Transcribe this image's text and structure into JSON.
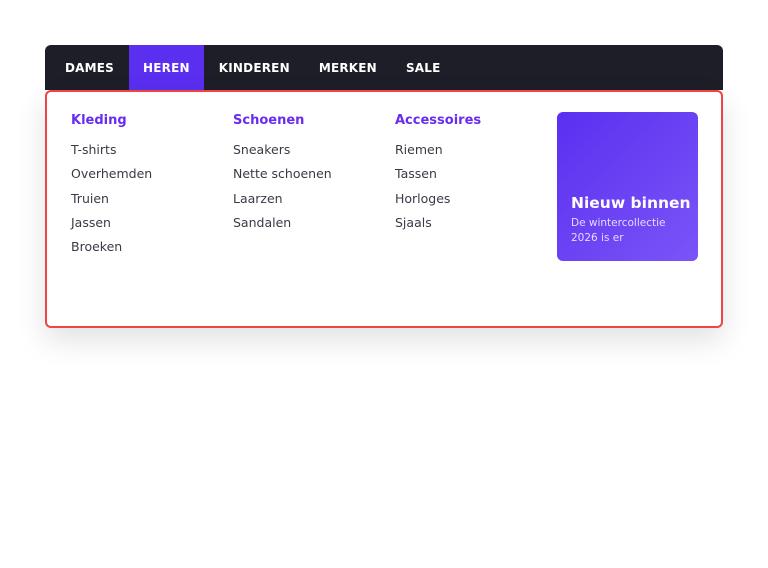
{
  "nav": {
    "items": [
      {
        "label": "DAMES",
        "active": false
      },
      {
        "label": "HEREN",
        "active": true
      },
      {
        "label": "KINDEREN",
        "active": false
      },
      {
        "label": "MERKEN",
        "active": false
      },
      {
        "label": "SALE",
        "active": false
      }
    ]
  },
  "menu": {
    "columns": [
      {
        "title": "Kleding",
        "links": [
          "T-shirts",
          "Overhemden",
          "Truien",
          "Jassen",
          "Broeken"
        ]
      },
      {
        "title": "Schoenen",
        "links": [
          "Sneakers",
          "Nette schoenen",
          "Laarzen",
          "Sandalen"
        ]
      },
      {
        "title": "Accessoires",
        "links": [
          "Riemen",
          "Tassen",
          "Horloges",
          "Sjaals"
        ]
      }
    ],
    "promo": {
      "title": "Nieuw binnen",
      "subtitle": "De wintercollectie 2026 is er"
    }
  },
  "colors": {
    "nav_bg": "#1e1e28",
    "accent": "#5a2ff0",
    "heading": "#6a2cf0",
    "highlight_border": "#ef4444"
  }
}
